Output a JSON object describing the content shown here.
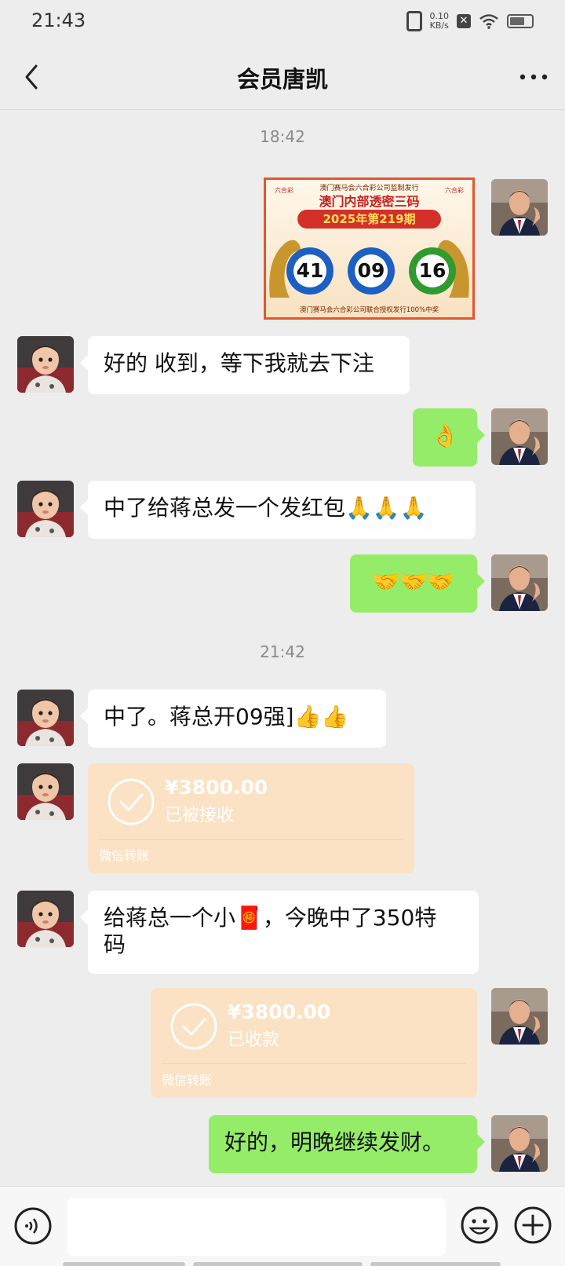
{
  "status_bar": {
    "time": "21:43",
    "speed_value": "0.10",
    "speed_unit": "KB/s"
  },
  "header": {
    "title": "会员唐凯"
  },
  "colors": {
    "outgoing_bubble": "#95ec69",
    "incoming_bubble": "#ffffff",
    "transfer_card": "#fbe2c4",
    "background": "#ededed"
  },
  "messages": {
    "ts1": "18:42",
    "lottery": {
      "top_text": "澳门赛马会六合彩公司监制发行",
      "title": "澳门内部透密三码",
      "issue": "2025年第219期",
      "balls": [
        "41",
        "09",
        "16"
      ],
      "bottom_text": "澳门赛马会六合彩公司联合授权发行100%中奖",
      "badge": "六合彩"
    },
    "m1": "好的 收到，等下我就去下注",
    "m2": "👌",
    "m3_text": "中了给蒋总发一个发红包",
    "m3_emoji": "🙏🙏🙏",
    "m4": "🤝🤝🤝",
    "ts2": "21:42",
    "m5_text": "中了。蒋总开09强]",
    "m5_emoji": "👍👍",
    "transfer1": {
      "amount": "¥3800.00",
      "status": "已被接收",
      "label": "微信转账"
    },
    "m6_line1": "给蒋总一个小🧧，今晚中了350特",
    "m6_line2": "码",
    "transfer2": {
      "amount": "¥3800.00",
      "status": "已收款",
      "label": "微信转账"
    },
    "m7": "好的，明晚继续发财。"
  },
  "icons": {
    "back": "chevron-left-icon",
    "more": "more-dots-icon",
    "voice": "voice-icon",
    "emoji": "emoji-face-icon",
    "plus": "plus-icon",
    "check": "check-circle-icon"
  }
}
